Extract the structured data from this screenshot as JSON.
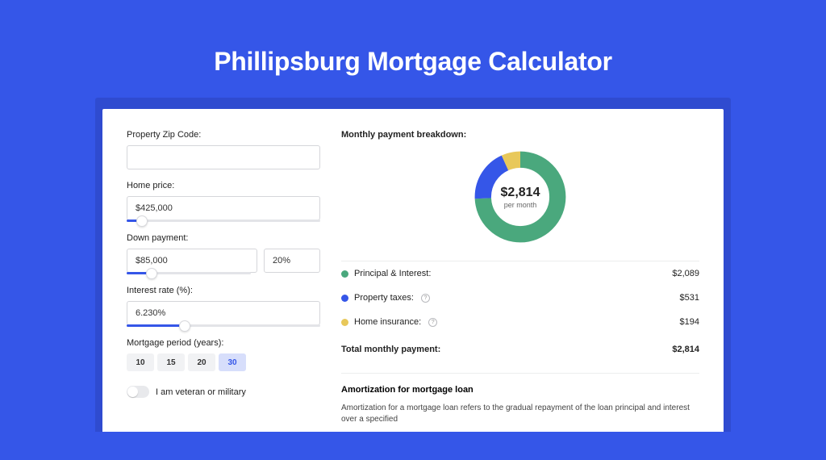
{
  "title": "Phillipsburg Mortgage Calculator",
  "colors": {
    "accent": "#3556e8",
    "green": "#4aa87d",
    "yellow": "#e8c85a",
    "blue": "#3556e8"
  },
  "form": {
    "zip": {
      "label": "Property Zip Code:",
      "value": ""
    },
    "home_price": {
      "label": "Home price:",
      "value": "$425,000",
      "slider_pct": 8
    },
    "down_payment": {
      "label": "Down payment:",
      "value": "$85,000",
      "pct_value": "20%",
      "slider_pct": 20
    },
    "interest_rate": {
      "label": "Interest rate (%):",
      "value": "6.230%",
      "slider_pct": 30
    },
    "mortgage_period": {
      "label": "Mortgage period (years):",
      "options": [
        "10",
        "15",
        "20",
        "30"
      ],
      "selected": "30"
    },
    "veteran": {
      "label": "I am veteran or military",
      "checked": false
    }
  },
  "breakdown": {
    "title": "Monthly payment breakdown:",
    "center_value": "$2,814",
    "center_sub": "per month",
    "items": [
      {
        "label": "Principal & Interest:",
        "value": "$2,089",
        "value_num": 2089,
        "color": "green",
        "help": false
      },
      {
        "label": "Property taxes:",
        "value": "$531",
        "value_num": 531,
        "color": "blue",
        "help": true
      },
      {
        "label": "Home insurance:",
        "value": "$194",
        "value_num": 194,
        "color": "yellow",
        "help": true
      }
    ],
    "total_label": "Total monthly payment:",
    "total_value": "$2,814",
    "total_num": 2814
  },
  "amortization": {
    "title": "Amortization for mortgage loan",
    "text": "Amortization for a mortgage loan refers to the gradual repayment of the loan principal and interest over a specified"
  },
  "chart_data": {
    "type": "pie",
    "title": "Monthly payment breakdown",
    "series": [
      {
        "name": "Principal & Interest",
        "value": 2089,
        "color": "#4aa87d"
      },
      {
        "name": "Property taxes",
        "value": 531,
        "color": "#3556e8"
      },
      {
        "name": "Home insurance",
        "value": 194,
        "color": "#e8c85a"
      }
    ],
    "total": 2814,
    "center_label": "$2,814 per month"
  }
}
